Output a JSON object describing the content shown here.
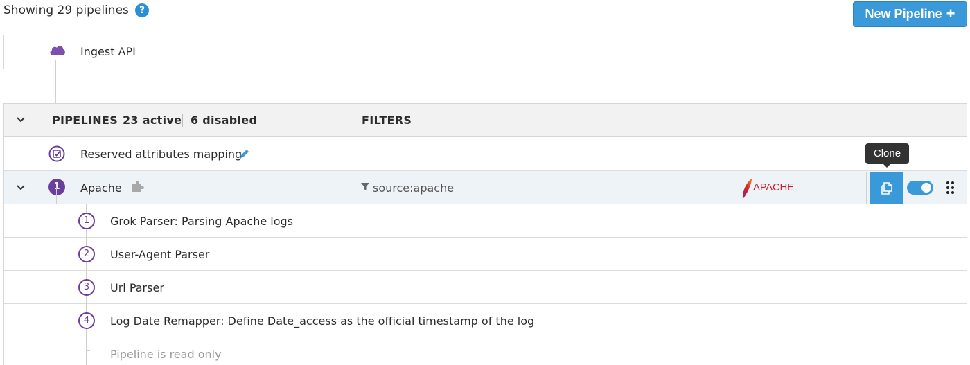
{
  "top": {
    "showing_label": "Showing 29 pipelines",
    "help_glyph": "?",
    "new_pipeline_label": "New Pipeline",
    "plus_glyph": "+"
  },
  "ingest": {
    "label": "Ingest API",
    "icon": "cloud-icon"
  },
  "header": {
    "pipelines_label": "PIPELINES",
    "active_label": "23 active",
    "disabled_label": "6 disabled",
    "filters_label": "FILTERS"
  },
  "reserved": {
    "label": "Reserved attributes mapping"
  },
  "apache": {
    "number": "1",
    "name": "Apache",
    "filter": "source:apache",
    "logo_text": "APACHE",
    "tooltip": "Clone",
    "enabled": true
  },
  "processors": [
    {
      "number": "1",
      "label": "Grok Parser: Parsing Apache logs"
    },
    {
      "number": "2",
      "label": "User-Agent Parser"
    },
    {
      "number": "3",
      "label": "Url Parser"
    },
    {
      "number": "4",
      "label": "Log Date Remapper: Define Date_access as the official timestamp of the log"
    }
  ],
  "readonly_label": "Pipeline is read only",
  "colors": {
    "accent": "#3a9ad9",
    "purple": "#6c3f9c"
  }
}
